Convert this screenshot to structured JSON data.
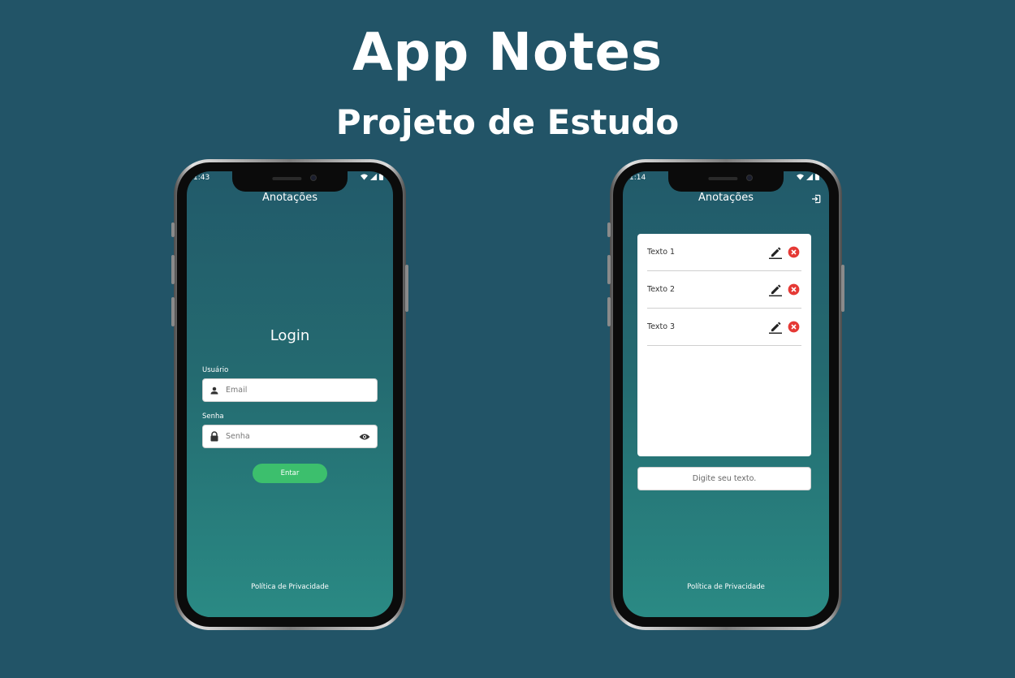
{
  "hero": {
    "title": "App Notes",
    "subtitle": "Projeto de Estudo"
  },
  "login_phone": {
    "status_time": "1:43",
    "app_title": "Anotações",
    "heading": "Login",
    "user_label": "Usuário",
    "email_placeholder": "Email",
    "password_label": "Senha",
    "password_placeholder": "Senha",
    "enter_label": "Entar",
    "footer": "Política de Privacidade"
  },
  "notes_phone": {
    "status_time": "1:14",
    "app_title": "Anotações",
    "notes": [
      {
        "text": "Texto 1"
      },
      {
        "text": "Texto 2"
      },
      {
        "text": "Texto 3"
      }
    ],
    "input_placeholder": "Digite seu texto.",
    "footer": "Política de Privacidade"
  },
  "colors": {
    "background": "#225467",
    "enter_button": "#3cbf6d",
    "delete_icon": "#e53935"
  }
}
